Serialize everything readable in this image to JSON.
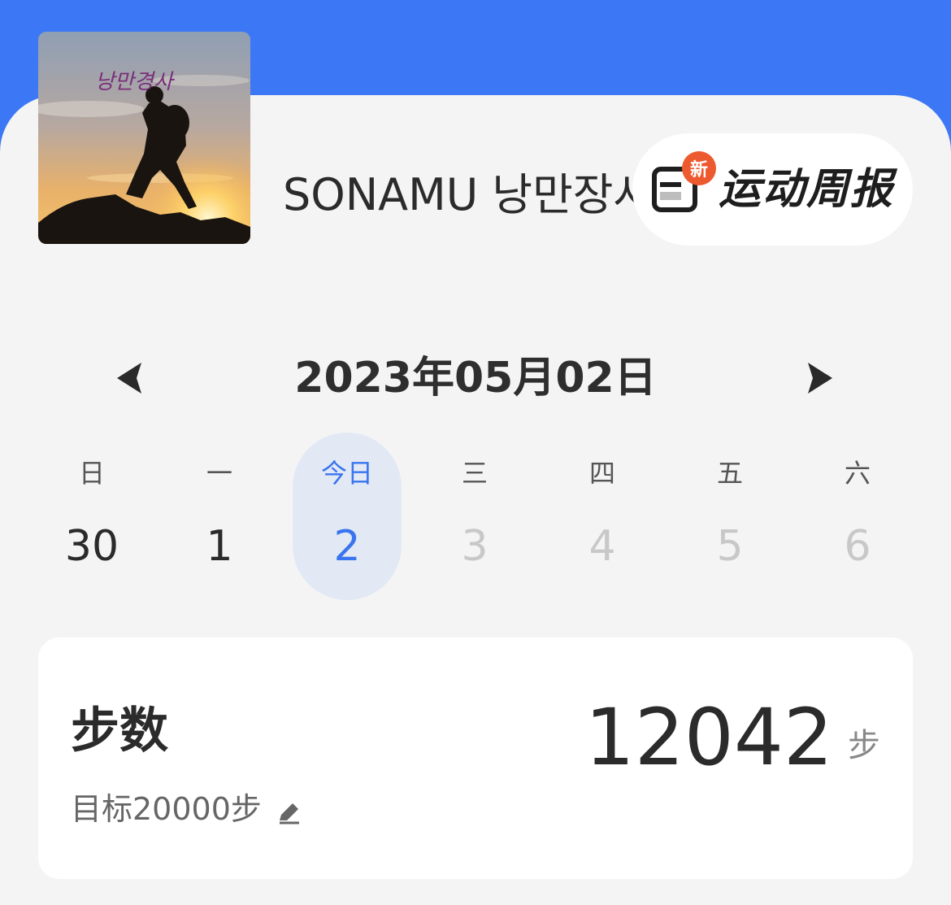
{
  "profile": {
    "username": "SONAMU 낭만장사",
    "avatar_caption": "낭만경사"
  },
  "weekly_report": {
    "label": "运动周报",
    "badge": "新",
    "icon": "report-icon"
  },
  "date_nav": {
    "current_date": "2023年05月02日",
    "prev_icon": "chevron-left-icon",
    "next_icon": "chevron-right-icon"
  },
  "week": [
    {
      "weekday": "日",
      "day": "30",
      "state": "past"
    },
    {
      "weekday": "一",
      "day": "1",
      "state": "past"
    },
    {
      "weekday": "今日",
      "day": "2",
      "state": "selected"
    },
    {
      "weekday": "三",
      "day": "3",
      "state": "future"
    },
    {
      "weekday": "四",
      "day": "4",
      "state": "future"
    },
    {
      "weekday": "五",
      "day": "5",
      "state": "future"
    },
    {
      "weekday": "六",
      "day": "6",
      "state": "future"
    }
  ],
  "steps": {
    "title": "步数",
    "value": "12042",
    "unit": "步",
    "goal": "目标20000步",
    "edit_icon": "pencil-icon"
  },
  "colors": {
    "header_blue": "#3c78f5",
    "selected_blue": "#3a74ee",
    "selected_bg": "#e2e9f5",
    "badge_orange": "#ee5a2f"
  }
}
